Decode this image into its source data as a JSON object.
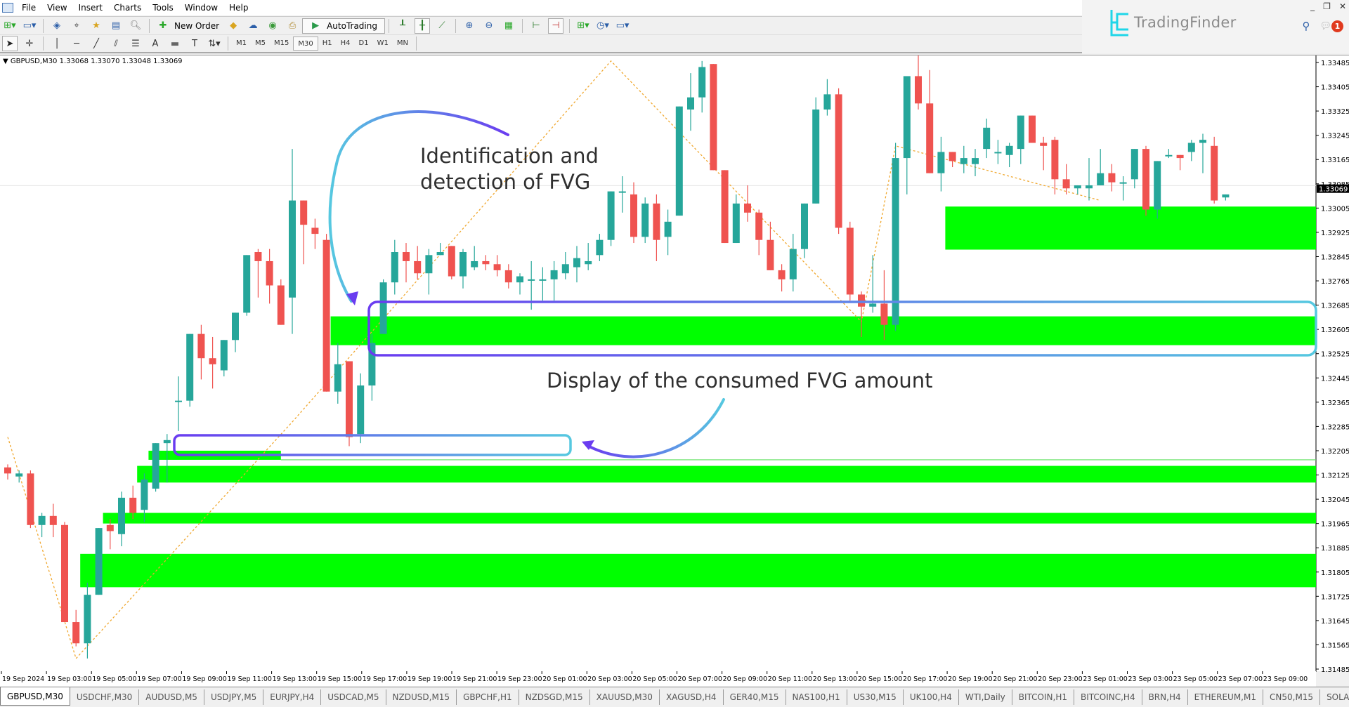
{
  "menu": [
    "File",
    "View",
    "Insert",
    "Charts",
    "Tools",
    "Window",
    "Help"
  ],
  "toolbar": {
    "new_order_label": "New Order",
    "autotrading_label": "AutoTrading",
    "timeframes": [
      "M1",
      "M5",
      "M15",
      "M30",
      "H1",
      "H4",
      "D1",
      "W1",
      "MN"
    ],
    "active_timeframe": "M30"
  },
  "brand": {
    "name": "TradingFinder",
    "accent": "#1fd6e8"
  },
  "notifications_count": "1",
  "window_buttons": [
    "_",
    "❐",
    "✕"
  ],
  "chart_header": "GBPUSD,M30  1.33068 1.33070 1.33048 1.33069",
  "annotations": {
    "top": [
      "Identification and",
      "detection of FVG"
    ],
    "bottom": "Display of the consumed FVG amount"
  },
  "colors": {
    "bull": "#26a69a",
    "bear": "#ef5350",
    "fvg": "#00ff00",
    "zigzag": "#f0a830",
    "box_a": "#6a3cf0",
    "box_b": "#56c8e0"
  },
  "tabs": [
    "GBPUSD,M30",
    "USDCHF,M30",
    "AUDUSD,M5",
    "USDJPY,M5",
    "EURJPY,H4",
    "USDCAD,M5",
    "NZDUSD,M15",
    "GBPCHF,H1",
    "NZDSGD,M15",
    "XAUUSD,M30",
    "XAGUSD,H4",
    "GER40,M15",
    "NAS100,H1",
    "US30,M15",
    "UK100,H4",
    "WTI,Daily",
    "BITCOIN,H1",
    "BITCOINC,H4",
    "BRN,H4",
    "ETHEREUM,M1",
    "CN50,M15",
    "SOLANA,Daily"
  ],
  "active_tab": 0,
  "chart_data": {
    "type": "candlestick",
    "symbol": "GBPUSD",
    "timeframe": "M30",
    "current_price": "1.33069",
    "ylim": [
      1.31485,
      1.33485
    ],
    "y_ticks": [
      "1.33485",
      "1.33405",
      "1.33325",
      "1.33245",
      "1.33165",
      "1.33085",
      "1.33005",
      "1.32925",
      "1.32845",
      "1.32765",
      "1.32685",
      "1.32605",
      "1.32525",
      "1.32445",
      "1.32365",
      "1.32285",
      "1.32205",
      "1.32125",
      "1.32045",
      "1.31965",
      "1.31885",
      "1.31805",
      "1.31725",
      "1.31645",
      "1.31565",
      "1.31485"
    ],
    "x_ticks": [
      "19 Sep 2024",
      "19 Sep 03:00",
      "19 Sep 05:00",
      "19 Sep 07:00",
      "19 Sep 09:00",
      "19 Sep 11:00",
      "19 Sep 13:00",
      "19 Sep 15:00",
      "19 Sep 17:00",
      "19 Sep 19:00",
      "19 Sep 21:00",
      "19 Sep 23:00",
      "20 Sep 01:00",
      "20 Sep 03:00",
      "20 Sep 05:00",
      "20 Sep 07:00",
      "20 Sep 09:00",
      "20 Sep 11:00",
      "20 Sep 13:00",
      "20 Sep 15:00",
      "20 Sep 17:00",
      "20 Sep 19:00",
      "20 Sep 21:00",
      "20 Sep 23:00",
      "23 Sep 01:00",
      "23 Sep 03:00",
      "23 Sep 05:00",
      "23 Sep 07:00",
      "23 Sep 09:00"
    ],
    "candles": [
      [
        1.3215,
        1.3216,
        1.3211,
        1.3213
      ],
      [
        1.3212,
        1.3214,
        1.321,
        1.3213
      ],
      [
        1.3213,
        1.3214,
        1.3195,
        1.3196
      ],
      [
        1.3196,
        1.32,
        1.3192,
        1.3199
      ],
      [
        1.3199,
        1.3203,
        1.3192,
        1.3196
      ],
      [
        1.3196,
        1.3197,
        1.3164,
        1.3164
      ],
      [
        1.3164,
        1.3168,
        1.3156,
        1.3157
      ],
      [
        1.3157,
        1.3177,
        1.3152,
        1.3173
      ],
      [
        1.3173,
        1.3195,
        1.3173,
        1.3195
      ],
      [
        1.3196,
        1.3198,
        1.3188,
        1.3194
      ],
      [
        1.3193,
        1.3207,
        1.3189,
        1.3205
      ],
      [
        1.3205,
        1.3209,
        1.3198,
        1.32
      ],
      [
        1.3201,
        1.3213,
        1.3197,
        1.3211
      ],
      [
        1.3208,
        1.3223,
        1.3207,
        1.3223
      ],
      [
        1.3223,
        1.3226,
        1.321,
        1.3224
      ],
      [
        1.3237,
        1.3245,
        1.3227,
        1.3237
      ],
      [
        1.3237,
        1.3259,
        1.3235,
        1.3259
      ],
      [
        1.3259,
        1.3262,
        1.3244,
        1.3251
      ],
      [
        1.3251,
        1.3258,
        1.3241,
        1.3249
      ],
      [
        1.3247,
        1.3257,
        1.3245,
        1.3257
      ],
      [
        1.3257,
        1.3266,
        1.3253,
        1.3266
      ],
      [
        1.3266,
        1.3285,
        1.3265,
        1.3285
      ],
      [
        1.3286,
        1.3287,
        1.3271,
        1.3283
      ],
      [
        1.3283,
        1.3287,
        1.3269,
        1.3275
      ],
      [
        1.3275,
        1.3277,
        1.3262,
        1.3262
      ],
      [
        1.3271,
        1.332,
        1.3259,
        1.3303
      ],
      [
        1.3303,
        1.3299,
        1.3282,
        1.3295
      ],
      [
        1.3294,
        1.3297,
        1.3287,
        1.3292
      ],
      [
        1.329,
        1.3292,
        1.324,
        1.324
      ],
      [
        1.324,
        1.3256,
        1.3236,
        1.3249
      ],
      [
        1.325,
        1.3248,
        1.3222,
        1.3225
      ],
      [
        1.3226,
        1.3246,
        1.3223,
        1.3242
      ],
      [
        1.3242,
        1.3259,
        1.3237,
        1.3256
      ],
      [
        1.3259,
        1.3277,
        1.3259,
        1.3276
      ],
      [
        1.3276,
        1.329,
        1.3272,
        1.3286
      ],
      [
        1.3286,
        1.3289,
        1.3276,
        1.3283
      ],
      [
        1.3283,
        1.3288,
        1.3277,
        1.3279
      ],
      [
        1.3279,
        1.3287,
        1.3272,
        1.3285
      ],
      [
        1.3285,
        1.3289,
        1.3285,
        1.3286
      ],
      [
        1.3288,
        1.3288,
        1.3277,
        1.3278
      ],
      [
        1.3278,
        1.3287,
        1.3274,
        1.3286
      ],
      [
        1.3281,
        1.3288,
        1.328,
        1.3283
      ],
      [
        1.3283,
        1.3285,
        1.328,
        1.3282
      ],
      [
        1.3282,
        1.3285,
        1.3278,
        1.328
      ],
      [
        1.328,
        1.3282,
        1.3274,
        1.3276
      ],
      [
        1.3276,
        1.3279,
        1.3272,
        1.3278
      ],
      [
        1.3277,
        1.3283,
        1.3267,
        1.3277
      ],
      [
        1.3277,
        1.3281,
        1.327,
        1.3277
      ],
      [
        1.3277,
        1.3283,
        1.327,
        1.328
      ],
      [
        1.3279,
        1.3286,
        1.3277,
        1.3282
      ],
      [
        1.3281,
        1.3288,
        1.3276,
        1.3284
      ],
      [
        1.3282,
        1.3289,
        1.328,
        1.3283
      ],
      [
        1.3285,
        1.3292,
        1.3283,
        1.329
      ],
      [
        1.329,
        1.3306,
        1.3288,
        1.3306
      ],
      [
        1.3306,
        1.3311,
        1.3299,
        1.3306
      ],
      [
        1.3305,
        1.3309,
        1.3289,
        1.3291
      ],
      [
        1.3291,
        1.3304,
        1.3289,
        1.3302
      ],
      [
        1.3302,
        1.3305,
        1.3283,
        1.329
      ],
      [
        1.3291,
        1.33,
        1.3285,
        1.3296
      ],
      [
        1.3298,
        1.333,
        1.3298,
        1.3334
      ],
      [
        1.3333,
        1.3345,
        1.3326,
        1.3337
      ],
      [
        1.3337,
        1.3349,
        1.3332,
        1.3347
      ],
      [
        1.3348,
        1.3348,
        1.3313,
        1.3313
      ],
      [
        1.3313,
        1.3301,
        1.3296,
        1.3289
      ],
      [
        1.3289,
        1.3305,
        1.33,
        1.3302
      ],
      [
        1.3302,
        1.3308,
        1.3296,
        1.3299
      ],
      [
        1.3299,
        1.33,
        1.3285,
        1.329
      ],
      [
        1.329,
        1.3296,
        1.3284,
        1.328
      ],
      [
        1.328,
        1.3282,
        1.3273,
        1.3277
      ],
      [
        1.3277,
        1.3292,
        1.3273,
        1.3287
      ],
      [
        1.3287,
        1.3302,
        1.3284,
        1.3302
      ],
      [
        1.3302,
        1.3337,
        1.3302,
        1.3333
      ],
      [
        1.3333,
        1.3343,
        1.3331,
        1.3338
      ],
      [
        1.3338,
        1.334,
        1.3292,
        1.3294
      ],
      [
        1.3294,
        1.3296,
        1.327,
        1.3272
      ],
      [
        1.3272,
        1.3273,
        1.3258,
        1.3268
      ],
      [
        1.3268,
        1.3285,
        1.3266,
        1.3269
      ],
      [
        1.3269,
        1.328,
        1.3257,
        1.3262
      ],
      [
        1.3262,
        1.3322,
        1.326,
        1.3317
      ],
      [
        1.3317,
        1.3336,
        1.3305,
        1.3344
      ],
      [
        1.3344,
        1.3356,
        1.3333,
        1.3335
      ],
      [
        1.3335,
        1.3346,
        1.332,
        1.3312
      ],
      [
        1.3312,
        1.3324,
        1.3306,
        1.3319
      ],
      [
        1.3319,
        1.3316,
        1.3314,
        1.3316
      ],
      [
        1.3315,
        1.3321,
        1.3312,
        1.3317
      ],
      [
        1.3315,
        1.332,
        1.3311,
        1.3317
      ],
      [
        1.332,
        1.333,
        1.3317,
        1.3327
      ],
      [
        1.3319,
        1.3323,
        1.3315,
        1.3319
      ],
      [
        1.3318,
        1.3322,
        1.3314,
        1.3321
      ],
      [
        1.332,
        1.3331,
        1.3315,
        1.3331
      ],
      [
        1.3331,
        1.3331,
        1.3322,
        1.3322
      ],
      [
        1.3322,
        1.3324,
        1.3313,
        1.3321
      ],
      [
        1.3323,
        1.3324,
        1.3305,
        1.331
      ],
      [
        1.331,
        1.3315,
        1.3305,
        1.3307
      ],
      [
        1.3307,
        1.3308,
        1.3305,
        1.3308
      ],
      [
        1.3307,
        1.3317,
        1.3303,
        1.3308
      ],
      [
        1.3308,
        1.332,
        1.3308,
        1.3312
      ],
      [
        1.3312,
        1.3315,
        1.3306,
        1.3309
      ],
      [
        1.3309,
        1.3311,
        1.3303,
        1.3309
      ],
      [
        1.331,
        1.3318,
        1.3307,
        1.332
      ],
      [
        1.332,
        1.3321,
        1.3298,
        1.33
      ],
      [
        1.33,
        1.3316,
        1.3297,
        1.3316
      ],
      [
        1.3318,
        1.332,
        1.3317,
        1.3318
      ],
      [
        1.3318,
        1.3318,
        1.3313,
        1.3317
      ],
      [
        1.3319,
        1.3323,
        1.3316,
        1.3322
      ],
      [
        1.3322,
        1.3325,
        1.3312,
        1.3323
      ],
      [
        1.3321,
        1.3324,
        1.3302,
        1.3303
      ],
      [
        1.3304,
        1.3305,
        1.3303,
        1.3305
      ]
    ],
    "fvg_zones": [
      {
        "from_bar": 28,
        "top": 1.32648,
        "bottom": 1.32553,
        "to_end": true
      },
      {
        "from_bar": 82,
        "top": 1.3301,
        "bottom": 1.32868,
        "to_end": true
      },
      {
        "from_bar": 12,
        "top": 1.32205,
        "bottom": 1.32175,
        "to_bar": 24,
        "consumed": true
      },
      {
        "from_bar": 11,
        "top": 1.32155,
        "bottom": 1.321,
        "to_end": true
      },
      {
        "from_bar": 8,
        "top": 1.32,
        "bottom": 1.31965,
        "to_end": true
      },
      {
        "from_bar": 6,
        "top": 1.31865,
        "bottom": 1.31755,
        "to_end": true
      }
    ],
    "zigzag": [
      [
        0,
        1.3225
      ],
      [
        6,
        1.3152
      ],
      [
        25,
        1.323
      ],
      [
        53,
        1.3349
      ],
      [
        75,
        1.3263
      ],
      [
        78,
        1.3321
      ],
      [
        96,
        1.3303
      ]
    ]
  }
}
